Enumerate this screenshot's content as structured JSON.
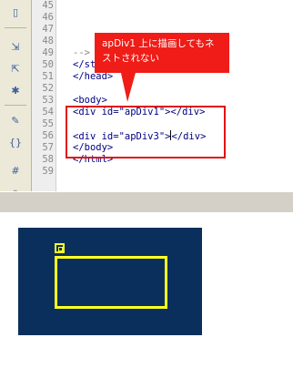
{
  "editor": {
    "lines": [
      {
        "num": "45",
        "code": ""
      },
      {
        "num": "46",
        "code": ""
      },
      {
        "num": "47",
        "code": ""
      },
      {
        "num": "48",
        "code": ""
      },
      {
        "num": "49",
        "code": "-->"
      },
      {
        "num": "50",
        "code": "</style>"
      },
      {
        "num": "51",
        "code": "</head>"
      },
      {
        "num": "52",
        "code": ""
      },
      {
        "num": "53",
        "code": "<body>"
      },
      {
        "num": "54",
        "code": "<div id=\"apDiv1\"></div>"
      },
      {
        "num": "55",
        "code": ""
      },
      {
        "num": "56",
        "code_before_caret": "<div id=\"apDiv3\">",
        "code_after_caret": "</div>"
      },
      {
        "num": "57",
        "code": "</body>"
      },
      {
        "num": "58",
        "code": "</html>"
      },
      {
        "num": "59",
        "code": ""
      }
    ]
  },
  "annotation": {
    "line1": "apDiv1 上に描画してもネ",
    "line2": "ストされない"
  },
  "colors": {
    "callout": "#ef1c17",
    "highlight_border": "#e01010",
    "canvas_bg": "#0b2f5c",
    "ap_border": "#ffff22"
  },
  "toolbar_icons": [
    "file-icon",
    "expand-tags-icon",
    "collapse-tags-icon",
    "select-parent-icon",
    "apply-comment-icon",
    "wrap-tag-icon",
    "recent-snippets-icon",
    "indent-icon",
    "more-icon"
  ]
}
